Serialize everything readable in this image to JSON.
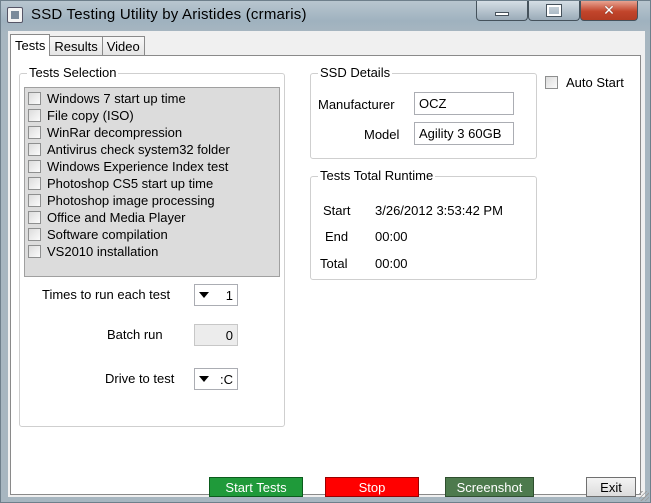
{
  "window": {
    "title": "SSD Testing Utility by Aristides (crmaris)",
    "close_glyph": "✕"
  },
  "tabs": [
    {
      "label": "Tests"
    },
    {
      "label": "Results"
    },
    {
      "label": "Video"
    }
  ],
  "tests_selection": {
    "title": "Tests Selection",
    "items": [
      "Windows 7 start up time",
      "File copy (ISO)",
      "WinRar decompression",
      "Antivirus check system32 folder",
      "Windows Experience Index test",
      "Photoshop CS5 start up time",
      "Photoshop image processing",
      "Office and Media Player",
      "Software compilation",
      "VS2010 installation"
    ],
    "times_label": "Times to run each test",
    "times_value": "1",
    "batch_label": "Batch run",
    "batch_value": "0",
    "drive_label": "Drive to test",
    "drive_value": ":C"
  },
  "ssd_details": {
    "title": "SSD Details",
    "manufacturer_label": "Manufacturer",
    "manufacturer_value": "OCZ",
    "model_label": "Model",
    "model_value": "Agility 3 60GB"
  },
  "auto_start": {
    "label": "Auto Start"
  },
  "runtime": {
    "title": "Tests Total Runtime",
    "start_label": "Start",
    "start_value": "3/26/2012 3:53:42 PM",
    "end_label": "End",
    "end_value": "00:00",
    "total_label": "Total",
    "total_value": "00:00"
  },
  "buttons": {
    "start": "Start Tests",
    "stop": "Stop",
    "screenshot": "Screenshot",
    "exit": "Exit"
  }
}
